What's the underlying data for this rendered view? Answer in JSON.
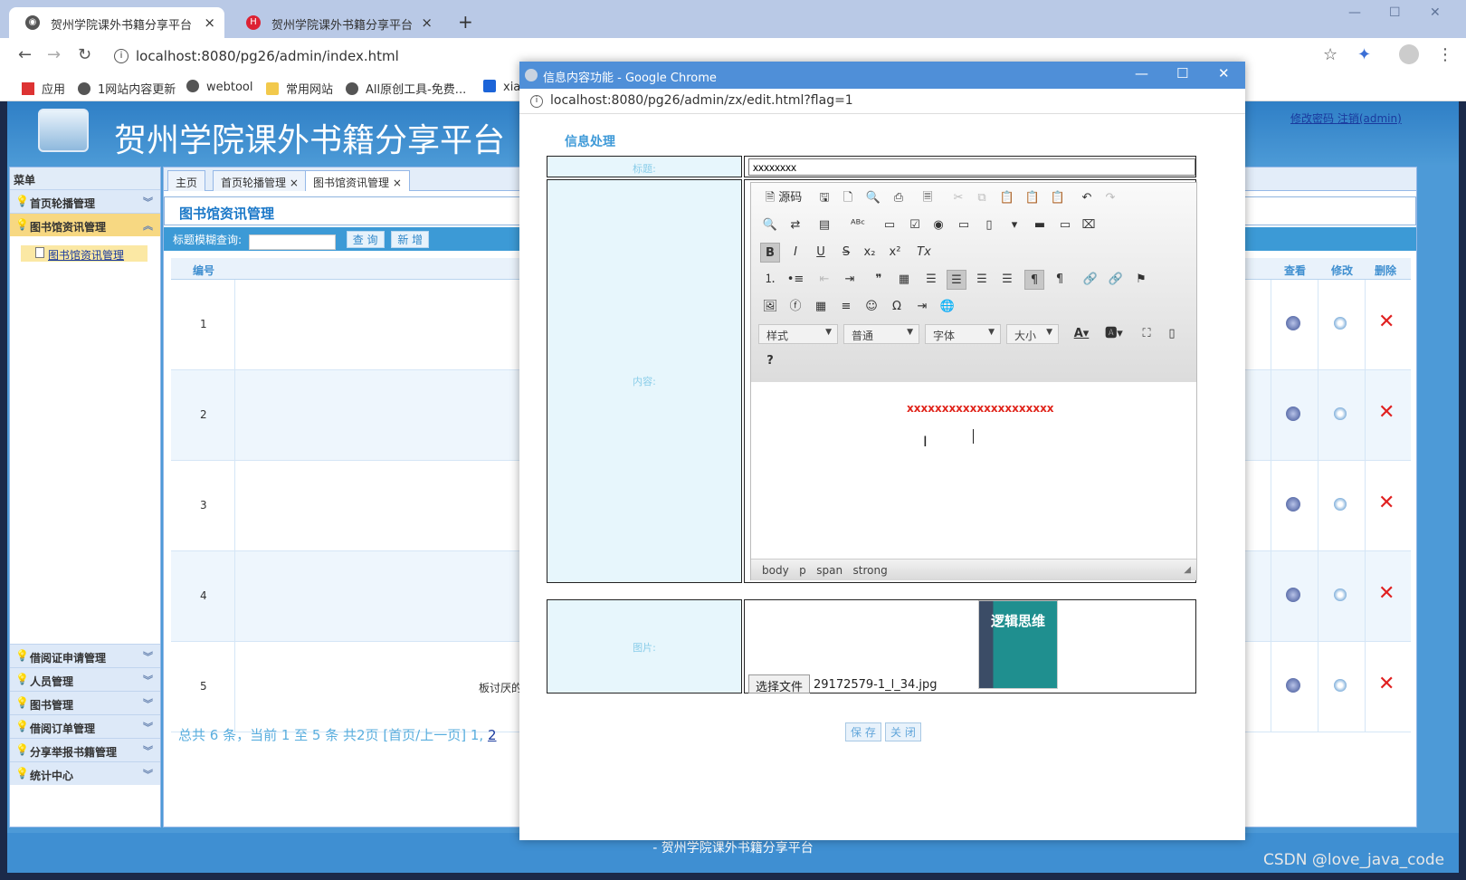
{
  "browser": {
    "tabs": [
      {
        "title": "贺州学院课外书籍分享平台",
        "active": true
      },
      {
        "title": "贺州学院课外书籍分享平台",
        "active": false
      }
    ],
    "new_tab": "+",
    "url": "localhost:8080/pg26/admin/index.html",
    "bookmarks": [
      "应用",
      "1网站内容更新",
      "webtool",
      "常用网站",
      "All原创工具-免费...",
      "xia"
    ],
    "controls": {
      "back": "←",
      "forward": "→",
      "reload": "↻",
      "star": "☆",
      "more": "⋮",
      "minimize": "—",
      "maximize": "☐",
      "close": "✕"
    }
  },
  "site": {
    "title": "贺州学院课外书籍分享平台",
    "change_password": "修改密码",
    "logout": "注销(admin)",
    "footer": "- 贺州学院课外书籍分享平台"
  },
  "sidebar": {
    "header": "菜单",
    "menus": [
      {
        "label": "首页轮播管理",
        "open": false
      },
      {
        "label": "图书馆资讯管理",
        "open": true
      }
    ],
    "sub_items": [
      "图书馆资讯管理"
    ],
    "bottom_menus": [
      "借阅证申请管理",
      "人员管理",
      "图书管理",
      "借阅订单管理",
      "分享举报书籍管理",
      "统计中心"
    ]
  },
  "main": {
    "tabs": [
      {
        "label": "主页",
        "closable": false
      },
      {
        "label": "首页轮播管理",
        "closable": true
      },
      {
        "label": "图书馆资讯管理",
        "closable": true,
        "active": true
      }
    ],
    "page_title": "图书馆资讯管理",
    "search": {
      "label": "标题模糊查询:",
      "value": "",
      "query_btn": "查 询",
      "add_btn": "新 增"
    },
    "columns": {
      "id": "编号",
      "view": "查看",
      "edit": "修改",
      "delete": "删除"
    },
    "rows": [
      "1",
      "2",
      "3",
      "4",
      "5"
    ],
    "row5_snippet": "板讨厌的",
    "pager": {
      "text": "总共 6 条，当前 1 至 5 条 共2页  [首页/上一页]",
      "p1": "1",
      "sep": ",",
      "p2": "2"
    }
  },
  "popup": {
    "window_title": "信息内容功能 - Google Chrome",
    "url": "localhost:8080/pg26/admin/zx/edit.html?flag=1",
    "form_title": "信息处理",
    "labels": {
      "title": "标题:",
      "content": "内容:",
      "image": "图片:"
    },
    "title_value": "xxxxxxxx",
    "editor": {
      "source_btn": "源码",
      "styles": "样式",
      "format": "普通",
      "font": "字体",
      "size": "大小",
      "help": "?",
      "content": "xxxxxxxxxxxxxxxxxxxxx",
      "path": [
        "body",
        "p",
        "span",
        "strong"
      ]
    },
    "file": {
      "button": "选择文件",
      "name": "29172579-1_l_34.jpg"
    },
    "book_cover_text": "逻辑思维",
    "buttons": {
      "save": "保 存",
      "close": "关 闭"
    }
  },
  "watermark": "CSDN @love_java_code"
}
